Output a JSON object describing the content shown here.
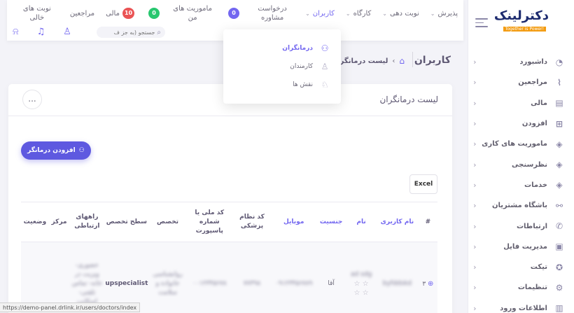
{
  "brand": {
    "logo_text": "دکترلینک",
    "tagline": "Together is Power!"
  },
  "sidebar": {
    "items": [
      {
        "label": "داشبورد",
        "icon": "speedometer-icon"
      },
      {
        "label": "مراجعین",
        "icon": "chart-icon"
      },
      {
        "label": "مالی",
        "icon": "wallet-icon"
      },
      {
        "label": "افزودن",
        "icon": "plus-square-icon"
      },
      {
        "label": "ماموریت های کاری",
        "icon": "layers-icon"
      },
      {
        "label": "نظرسنجی",
        "icon": "layers-icon"
      },
      {
        "label": "خدمات",
        "icon": "layers-icon"
      },
      {
        "label": "باشگاه مشتریان",
        "icon": "network-icon"
      },
      {
        "label": "ارتباطات",
        "icon": "phone-icon"
      },
      {
        "label": "مدیریت فایل",
        "icon": "file-icon"
      },
      {
        "label": "تیکت",
        "icon": "badge-icon"
      },
      {
        "label": "تنظیمات",
        "icon": "gear-icon"
      },
      {
        "label": "اطلاعات ورود",
        "icon": "book-icon"
      }
    ]
  },
  "navbar": {
    "items": [
      {
        "label": "پذیرش",
        "has_chevron": true
      },
      {
        "label": "نوبت دهی",
        "has_chevron": true
      },
      {
        "label": "کارگاه",
        "has_chevron": true
      },
      {
        "label": "کاربران",
        "has_chevron": true,
        "active": true
      },
      {
        "label": "درخواست مشاوره",
        "has_chevron": false
      },
      {
        "label": "",
        "badge": "0",
        "badge_color": "#7367f0"
      },
      {
        "label": "ماموریت های من",
        "has_chevron": false
      },
      {
        "label": "",
        "badge": "0",
        "badge_color": "#28c76f"
      },
      {
        "label": "مالی",
        "badge": "10",
        "badge_color": "#ea5455"
      },
      {
        "label": "مراجعین",
        "has_chevron": false
      },
      {
        "label": "نوبت های خالی",
        "has_chevron": false
      }
    ],
    "search_placeholder": "جستجو (به جز ف"
  },
  "users_dropdown": {
    "items": [
      {
        "label": "درمانگران",
        "active": true
      },
      {
        "label": "کارمندان",
        "active": false
      },
      {
        "label": "نقش ها",
        "active": false
      }
    ]
  },
  "breadcrumb": {
    "page_title": "کاربران",
    "current": "لیست درمانگران"
  },
  "card": {
    "title": "لیست درمانگران",
    "more_label": "...",
    "add_button_label": "افزودن درمانگر",
    "excel_label": "Excel"
  },
  "table": {
    "headers": [
      "#",
      "نام کاربری",
      "نام",
      "جنسیت",
      "موبایل",
      "کد نظام پزشکی",
      "کد ملی یا شماره پاسپورت",
      "تخصص",
      "سطح تخصص",
      "راههای ارتباطی",
      "مرکز",
      "وضعیت"
    ],
    "rows": [
      {
        "index": "۳",
        "username": "byfddskd",
        "name": "ad sdg",
        "gender": "آقا",
        "mobile": "۰۹۱۲۳۴۵۶۷۸۹",
        "medical_code": "۷۷۳۹۸",
        "national_id": "۰۰۱۲۳۴۵۶۷۸",
        "specialty": "روانشناسی خانواده و سلامت",
        "level": "upspecialist",
        "contacts": "حضوری- ویزیت در خانه- تماس تلفنی- اسکایپ",
        "center": "",
        "status": ""
      }
    ]
  },
  "statusbar": {
    "url": "https://demo-panel.drlink.ir/users/doctors/index"
  }
}
